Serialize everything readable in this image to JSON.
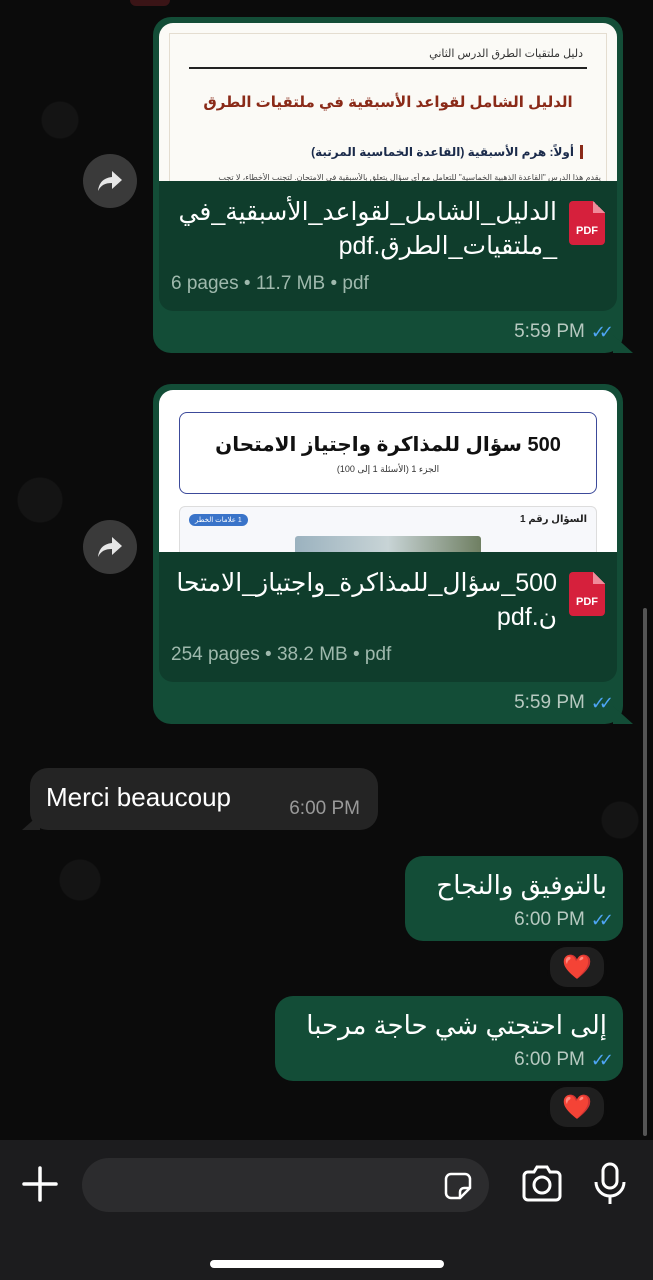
{
  "messages": [
    {
      "type": "document",
      "preview": {
        "header": "دليل ملتقيات الطرق الدرس الثاني",
        "title": "الدليل الشامل لقواعد الأسبقية في ملتقيات الطرق",
        "section": "أولاً: هرم الأسبقية (القاعدة الخماسية المرتبة)",
        "line": "يقدم هذا الدرس \"القاعدة الذهبية الخماسية\" للتعامل مع أي سؤال يتعلق بالأسبقية في الامتحان. لتجنب الأخطاء، لا تجب"
      },
      "file_name": "الدليل_الشامل_لقواعد_الأسبقية_في_ملتقيات_الطرق.pdf",
      "file_icon_label": "PDF",
      "meta": "6 pages • 11.7 MB • pdf",
      "time": "5:59 PM",
      "status": "read"
    },
    {
      "type": "document",
      "preview": {
        "title": "500 سؤال للمذاكرة واجتياز الامتحان",
        "subtitle": "الجزء 1 (الأسئلة 1 إلى 100)",
        "q_label": "السؤال رقم 1",
        "badge": "1 علامات الخطر"
      },
      "file_name": "500_سؤال_للمذاكرة_واجتياز_الامتحان.pdf",
      "file_icon_label": "PDF",
      "meta": "254 pages • 38.2 MB • pdf",
      "time": "5:59 PM",
      "status": "read"
    },
    {
      "type": "incoming",
      "text": "Merci beaucoup",
      "time": "6:00 PM"
    },
    {
      "type": "outgoing",
      "text": "بالتوفيق والنجاح",
      "time": "6:00 PM",
      "status": "read",
      "reaction": "❤️"
    },
    {
      "type": "outgoing",
      "text": "إلى احتجتي شي حاجة مرحبا",
      "time": "6:00 PM",
      "status": "read",
      "reaction": "❤️"
    }
  ],
  "composer": {
    "placeholder": "",
    "icons": [
      "plus-icon",
      "sticker-icon",
      "camera-icon",
      "microphone-icon"
    ]
  },
  "colors": {
    "outgoing_bubble": "#134d37",
    "incoming_bubble": "#242424",
    "read_ticks": "#4ea5f5",
    "background": "#0b0b0b"
  }
}
